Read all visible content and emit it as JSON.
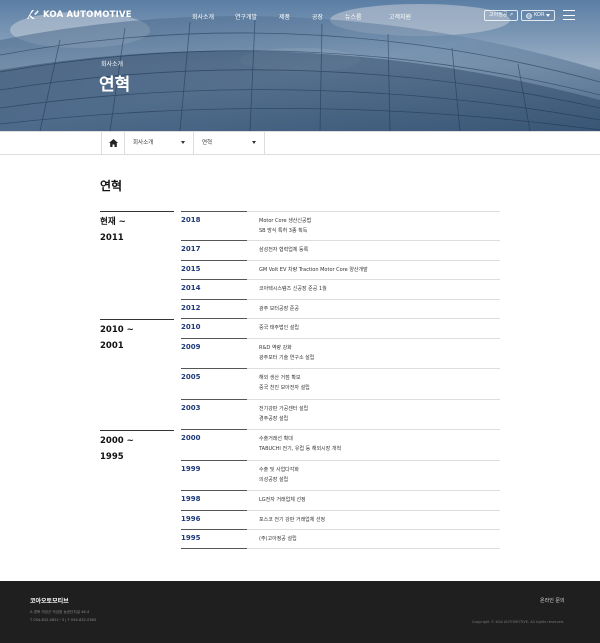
{
  "header": {
    "logo_text": "KOA AUTOMOTIVE",
    "nav": [
      "회사소개",
      "연구개발",
      "제품",
      "공장",
      "뉴스룸",
      "고객지원"
    ],
    "ir_label": "고아정공 ↗",
    "lang_label": "KOR",
    "hero_subtitle": "회사소개",
    "hero_title": "연혁"
  },
  "breadcrumb": {
    "level1": "회사소개",
    "level2": "연혁"
  },
  "main": {
    "title": "연혁",
    "periods": [
      {
        "line1": "현재 ~",
        "line2": "2011"
      },
      {
        "line1": "2010 ~",
        "line2": "2001"
      },
      {
        "line1": "2000 ~",
        "line2": "1995"
      }
    ],
    "history": [
      {
        "year": "2018",
        "events": [
          "Motor Core 생산신공법",
          "SB 방식 특허 3종 획득"
        ]
      },
      {
        "year": "2017",
        "events": [
          "삼성전자 협력업체 등록"
        ]
      },
      {
        "year": "2015",
        "events": [
          "GM Volt EV 차량 Traction Motor Core 양산개발"
        ]
      },
      {
        "year": "2014",
        "events": [
          "코아텍시스템즈 신공장 준공 1월"
        ]
      },
      {
        "year": "2012",
        "events": [
          "광주 모터공장 준공"
        ]
      },
      {
        "year": "2010",
        "events": [
          "중국 태주법인 설립"
        ]
      },
      {
        "year": "2009",
        "events": [
          "R&D 역량 강화",
          "광주모터 기술 연구소 설립"
        ]
      },
      {
        "year": "2005",
        "events": [
          "해외 생산 거점 확보",
          "중국 천진 보아전자 설립"
        ]
      },
      {
        "year": "2003",
        "events": [
          "전기강판 가공센터 설립",
          "경주공장 설립"
        ]
      },
      {
        "year": "2000",
        "events": [
          "수출거래선 확대",
          "TABUCHI 전기, 유럽 등 해외시장 개척"
        ]
      },
      {
        "year": "1999",
        "events": [
          "수출 및 사업다각화",
          "의성공장 설립"
        ]
      },
      {
        "year": "1998",
        "events": [
          "LG전자 거래업체 선정"
        ]
      },
      {
        "year": "1996",
        "events": [
          "포스코 전기 강판 거래업체 선정"
        ]
      },
      {
        "year": "1995",
        "events": [
          "(주)고아정공 설립"
        ]
      }
    ]
  },
  "footer": {
    "company": "코아오토모티브",
    "address": "A  경북 의성군 의성읍 농공단지길 46-4",
    "phone": "T  054-832-0851~3   |   F  054-832-0365",
    "link": "온라인 문의",
    "copyright": "Copyright © KOA AUTOMOTIVE. All rights reserved."
  },
  "colors": {
    "year_accent": "#1e3a7a",
    "footer_bg": "#1f1f1f"
  },
  "icons": {
    "logo": "koa-logo-icon",
    "home": "home-icon",
    "globe": "globe-icon",
    "menu": "hamburger-menu-icon"
  }
}
